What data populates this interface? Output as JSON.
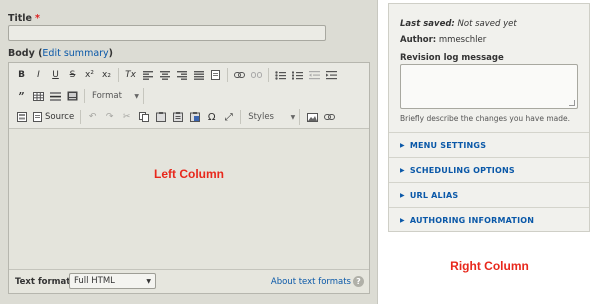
{
  "left": {
    "title_label": "Title",
    "required_mark": "*",
    "body_label": "Body",
    "edit_summary_link": "Edit summary",
    "toolbar": {
      "row1": [
        "B",
        "I",
        "U",
        "S",
        "x²",
        "x₂",
        "Tx",
        "≡",
        "≡",
        "≡",
        "≡",
        "⎘",
        "🔗",
        "⛓",
        "☰",
        "☰",
        "⇤",
        "⇥"
      ],
      "row2": [
        "❞",
        "▦",
        "▤",
        "▣"
      ],
      "format_label": "Format",
      "row3_source_label": "Source",
      "styles_label": "Styles"
    },
    "column_caption": "Left Column",
    "text_format_label": "Text format",
    "text_format_value": "Full HTML",
    "about_formats_link": "About text formats",
    "help_icon": "?"
  },
  "right": {
    "last_saved_label": "Last saved:",
    "last_saved_value": "Not saved yet",
    "author_label": "Author:",
    "author_value": "mmeschler",
    "revision_log_label": "Revision log message",
    "revision_log_desc": "Briefly describe the changes you have made.",
    "sections": [
      "MENU SETTINGS",
      "SCHEDULING OPTIONS",
      "URL ALIAS",
      "AUTHORING INFORMATION"
    ],
    "column_caption": "Right Column"
  }
}
